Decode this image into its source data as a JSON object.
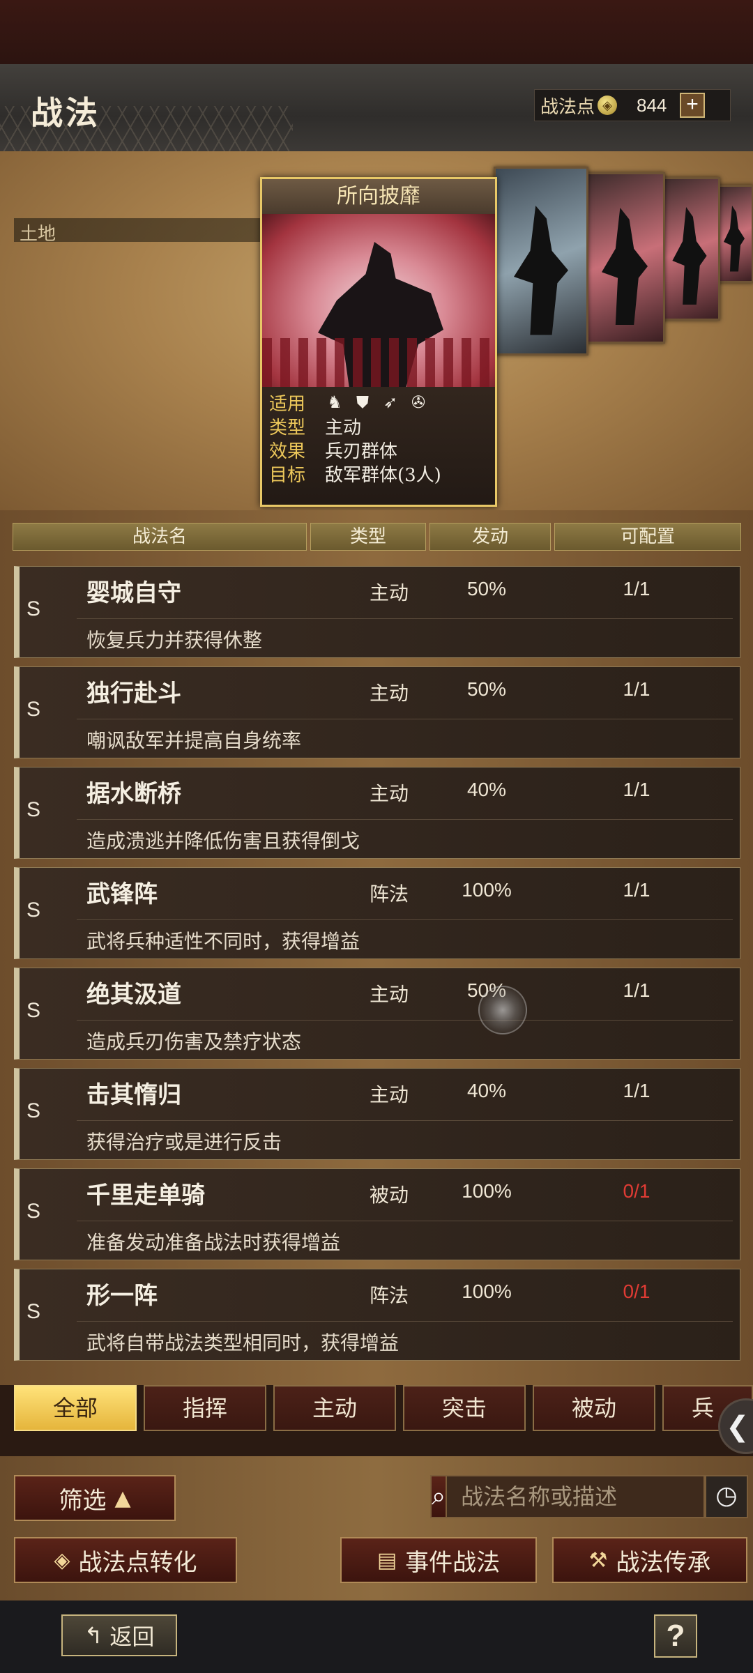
{
  "header": {
    "title": "战法",
    "points_label": "战法点",
    "points_value": "844",
    "plus": "+"
  },
  "showcase": {
    "banner_text": "土地",
    "card": {
      "title": "所向披靡",
      "rows": [
        {
          "key": "适用",
          "value": ""
        },
        {
          "key": "类型",
          "value": "主动"
        },
        {
          "key": "效果",
          "value": "兵刃群体"
        },
        {
          "key": "目标",
          "value": "敌军群体(3人)"
        }
      ],
      "unit_icons": [
        "cavalry-icon",
        "shield-icon",
        "archer-icon",
        "chariot-icon"
      ]
    }
  },
  "table": {
    "headers": [
      "战法名",
      "类型",
      "发动",
      "可配置"
    ],
    "rows": [
      {
        "rank": "S",
        "name": "婴城自守",
        "type": "主动",
        "rate": "50%",
        "count": "1/1",
        "desc": "恢复兵力并获得休整",
        "full": false
      },
      {
        "rank": "S",
        "name": "独行赴斗",
        "type": "主动",
        "rate": "50%",
        "count": "1/1",
        "desc": "嘲讽敌军并提高自身统率",
        "full": false
      },
      {
        "rank": "S",
        "name": "据水断桥",
        "type": "主动",
        "rate": "40%",
        "count": "1/1",
        "desc": "造成溃逃并降低伤害且获得倒戈",
        "full": false
      },
      {
        "rank": "S",
        "name": "武锋阵",
        "type": "阵法",
        "rate": "100%",
        "count": "1/1",
        "desc": "武将兵种适性不同时，获得增益",
        "full": false
      },
      {
        "rank": "S",
        "name": "绝其汲道",
        "type": "主动",
        "rate": "50%",
        "count": "1/1",
        "desc": "造成兵刃伤害及禁疗状态",
        "full": false
      },
      {
        "rank": "S",
        "name": "击其惰归",
        "type": "主动",
        "rate": "40%",
        "count": "1/1",
        "desc": "获得治疗或是进行反击",
        "full": false
      },
      {
        "rank": "S",
        "name": "千里走单骑",
        "type": "被动",
        "rate": "100%",
        "count": "0/1",
        "desc": "准备发动准备战法时获得增益",
        "full": true
      },
      {
        "rank": "S",
        "name": "形一阵",
        "type": "阵法",
        "rate": "100%",
        "count": "0/1",
        "desc": "武将自带战法类型相同时，获得增益",
        "full": true
      }
    ]
  },
  "tabs": [
    "全部",
    "指挥",
    "主动",
    "突击",
    "被动",
    "兵"
  ],
  "bottom": {
    "filter_label": "筛选",
    "search_placeholder": "战法名称或描述",
    "convert_label": "战法点转化",
    "event_label": "事件战法",
    "inherit_label": "战法传承"
  },
  "footer": {
    "back_label": "返回",
    "help_label": "?"
  },
  "colors": {
    "accent_gold": "#e8c867",
    "count_unavailable": "#e03b34",
    "tab_active": "#e5b53c"
  }
}
